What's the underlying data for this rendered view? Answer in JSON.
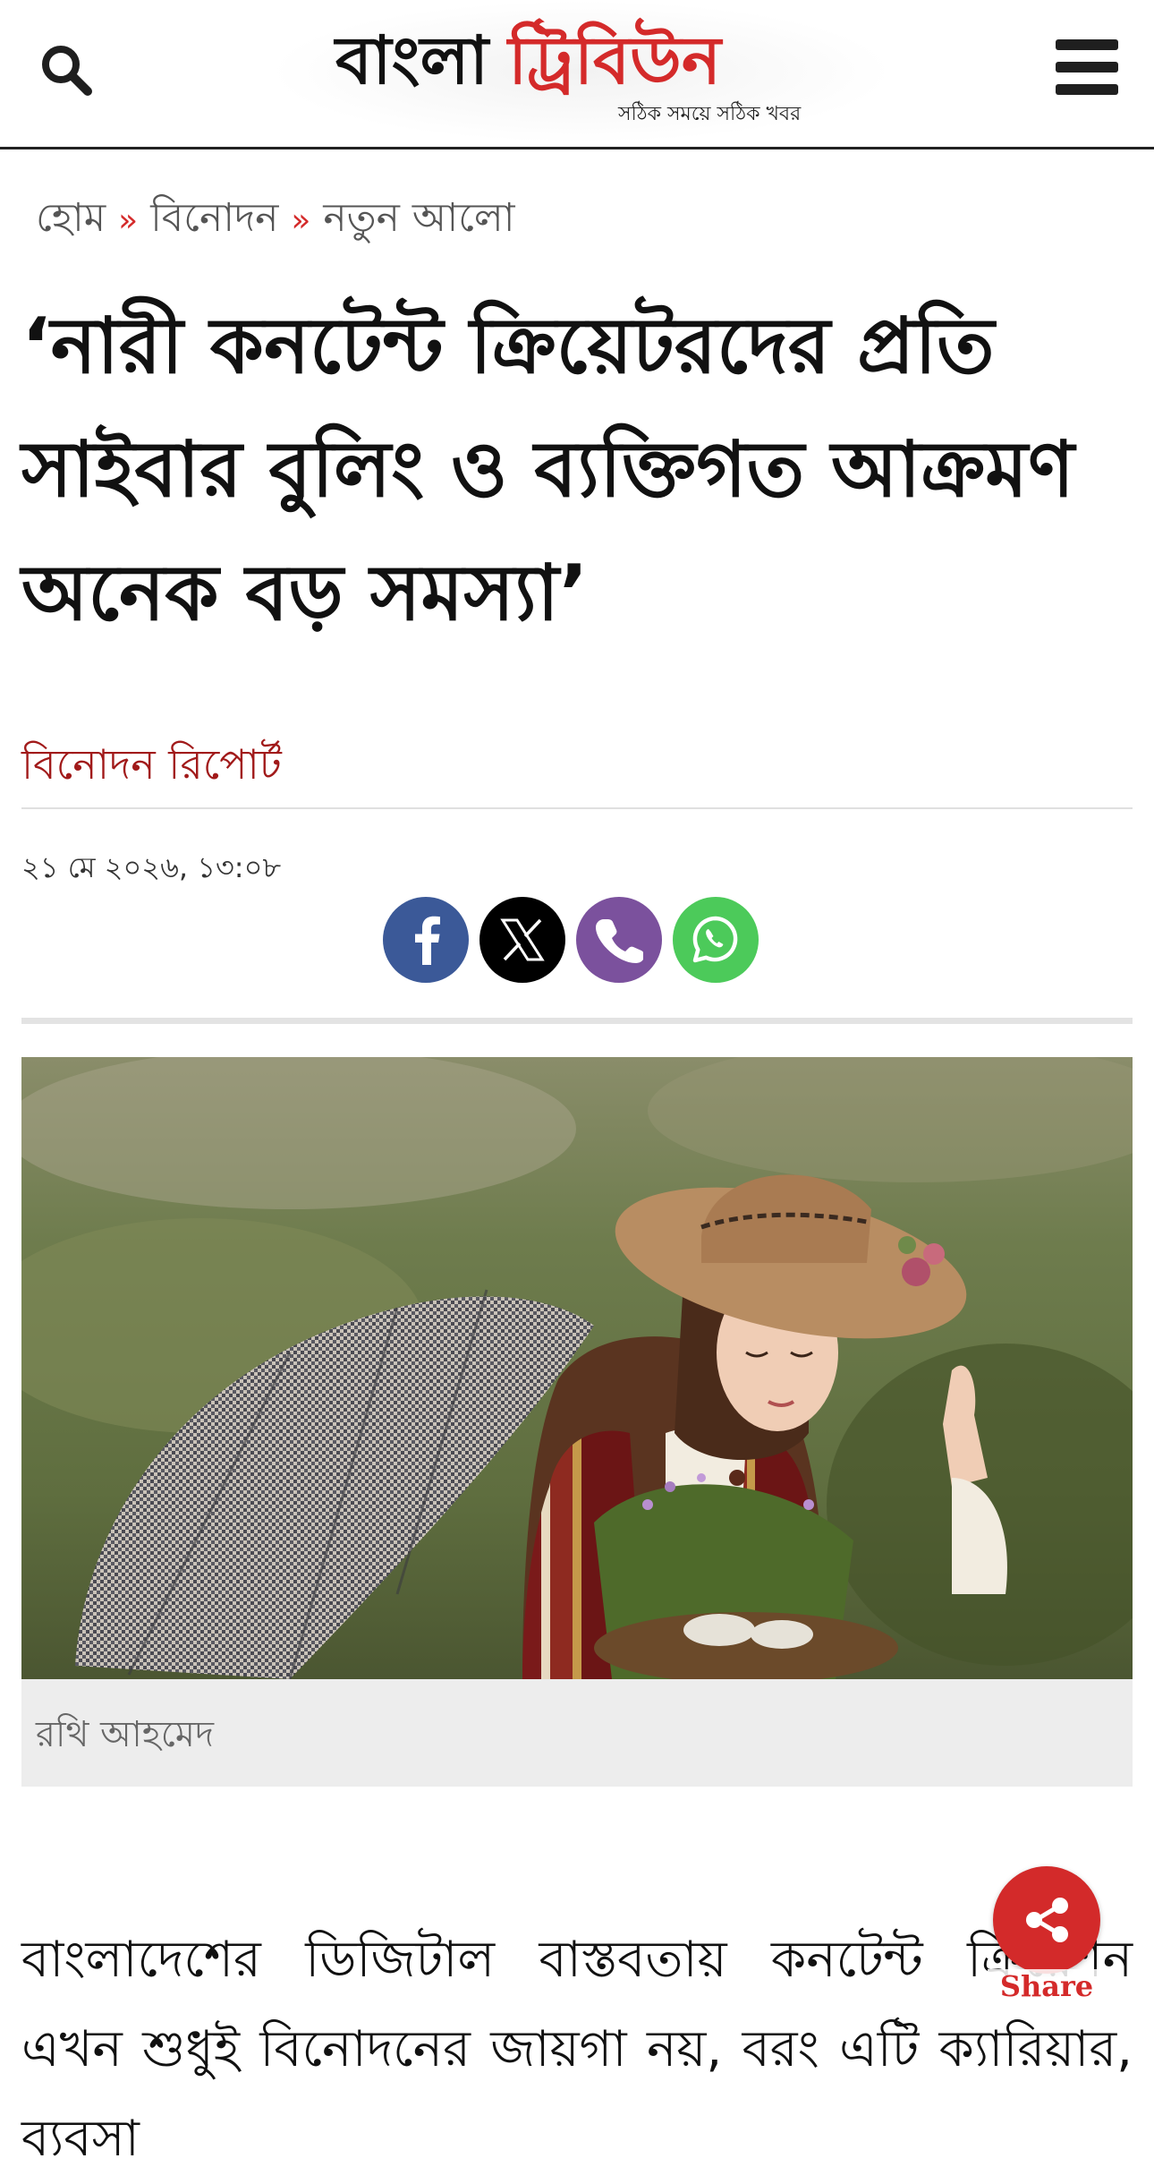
{
  "header": {
    "logo_part1": "বাংলা",
    "logo_part2": "ট্রিবিউন",
    "tagline": "সঠিক সময়ে সঠিক খবর",
    "search_icon": "search-icon",
    "menu_icon": "hamburger-menu-icon"
  },
  "breadcrumb": {
    "items": [
      "হোম",
      "বিনোদন",
      "নতুন আলো"
    ],
    "separator": "»"
  },
  "article": {
    "headline": "‘নারী কনটেন্ট ক্রিয়েটরদের প্রতি সাইবার বুলিং ও ব্যক্তিগত আক্রমণ অনেক বড় সমস্যা’",
    "author": "বিনোদন রিপোর্ট",
    "date": "২১ মে ২০২৬, ১৩:০৮",
    "image_caption": "রথি আহমেদ",
    "body_start": "বাংলাদেশের ডিজিটাল বাস্তবতায় কনটেন্ট ক্রিয়েশন এখন শুধুই বিনোদনের জায়গা নয়, বরং এটি ক্যারিয়ার, ব্যবসা"
  },
  "share": {
    "buttons": [
      {
        "name": "facebook",
        "icon": "facebook-icon",
        "color": "#3b5998"
      },
      {
        "name": "x",
        "icon": "x-icon",
        "color": "#000000"
      },
      {
        "name": "viber",
        "icon": "phone-icon",
        "color": "#7b519d"
      },
      {
        "name": "whatsapp",
        "icon": "whatsapp-icon",
        "color": "#4cca5a"
      }
    ],
    "fab_label": "Share",
    "fab_color": "#d32a2a"
  },
  "colors": {
    "brand_red": "#d42a2a",
    "author_red": "#a11a1a"
  }
}
